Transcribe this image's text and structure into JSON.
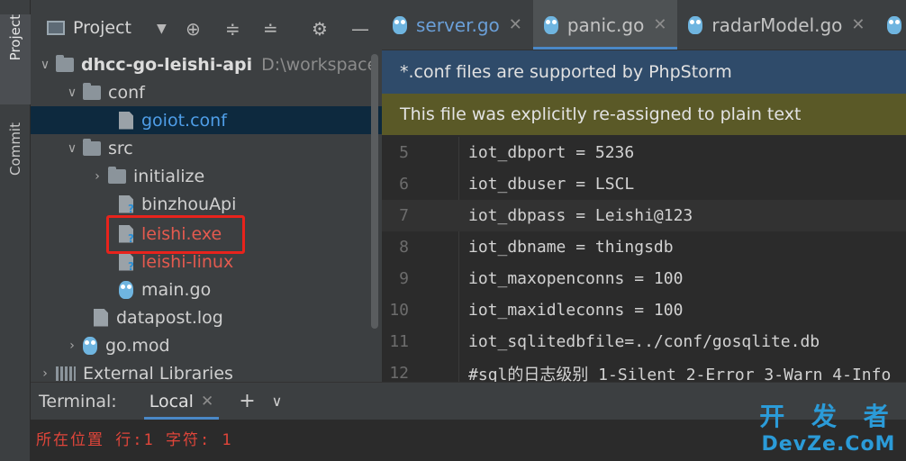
{
  "stripe": {
    "project_label": "Project",
    "commit_label": "Commit"
  },
  "panel": {
    "title": "Project",
    "header_icons": [
      "chevron-down-icon",
      "crosshair-icon",
      "expand-all-icon",
      "collapse-all-icon",
      "gear-icon",
      "minimize-icon"
    ]
  },
  "tree": {
    "root_name": "dhcc-go-leishi-api",
    "root_path": "D:\\workspace",
    "conf": "conf",
    "goiot_conf": "goiot.conf",
    "src": "src",
    "initialize": "initialize",
    "binzhouApi": "binzhouApi",
    "leishi_exe": "leishi.exe",
    "leishi_linux": "leishi-linux",
    "main_go": "main.go",
    "datapost_log": "datapost.log",
    "go_mod": "go.mod",
    "external_libraries": "External Libraries"
  },
  "tabs": [
    {
      "label": "server.go"
    },
    {
      "label": "panic.go"
    },
    {
      "label": "radarModel.go"
    },
    {
      "label": "fl"
    }
  ],
  "banners": {
    "supported": "*.conf files are supported by PhpStorm",
    "reassigned": "This file was explicitly re-assigned to plain text"
  },
  "code_lines": [
    {
      "num": "5",
      "text": "iot_dbport = 5236"
    },
    {
      "num": "6",
      "text": "iot_dbuser = LSCL"
    },
    {
      "num": "7",
      "text": "iot_dbpass = Leishi@123"
    },
    {
      "num": "8",
      "text": "iot_dbname = thingsdb"
    },
    {
      "num": "9",
      "text": "iot_maxopenconns = 100"
    },
    {
      "num": "10",
      "text": "iot_maxidleconns = 100"
    },
    {
      "num": "11",
      "text": "iot_sqlitedbfile=../conf/gosqlite.db"
    },
    {
      "num": "12",
      "text": "#sql的日志级别 1-Silent 2-Error 3-Warn 4-Info"
    }
  ],
  "terminal": {
    "label": "Terminal:",
    "tab_local": "Local",
    "output": "所在位置 行:1 字符: 1"
  },
  "watermark": {
    "top": "开 发 者",
    "bottom": "DevZe.CoM"
  },
  "colors": {
    "highlight": "#e8231c",
    "accent": "#4a88c7",
    "error_text": "#e0453a"
  }
}
